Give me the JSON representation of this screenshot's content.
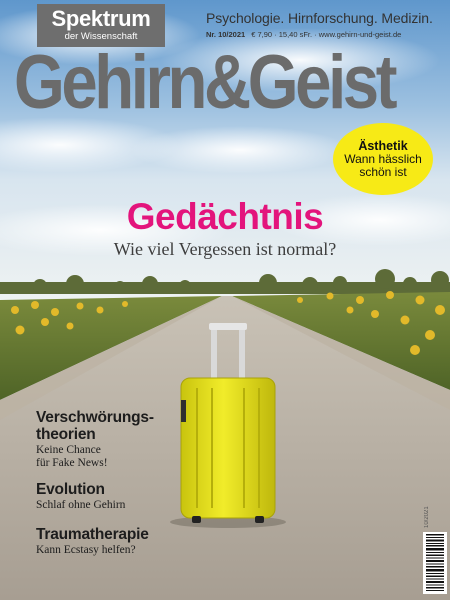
{
  "brand": {
    "publisher_name": "Spektrum",
    "publisher_sub": "der Wissenschaft",
    "tagline": "Psychologie. Hirnforschung. Medizin.",
    "issue": "Nr. 10/2021",
    "price_and_url": "€ 7,90 · 15,40 sFr. · www.gehirn-und-geist.de",
    "magazine_title": "Gehirn&Geist"
  },
  "badge": {
    "title": "Ästhetik",
    "text": "Wann hässlich schön ist",
    "color": "#f7ea16"
  },
  "headline": {
    "title": "Gedächtnis",
    "subtitle": "Wie viel Vergessen ist normal?",
    "color": "#e3147c"
  },
  "teasers": [
    {
      "title": "Verschwörungs-\ntheorien",
      "text": "Keine Chance\nfür Fake News!"
    },
    {
      "title": "Evolution",
      "text": "Schlaf ohne Gehirn"
    },
    {
      "title": "Traumatherapie",
      "text": "Kann Ecstasy helfen?"
    }
  ],
  "side_code": "10/2021",
  "colors": {
    "masthead_gray": "#6b6b6b",
    "suitcase_yellow": "#e9e318",
    "sky_blue": "#6fa3d4"
  }
}
